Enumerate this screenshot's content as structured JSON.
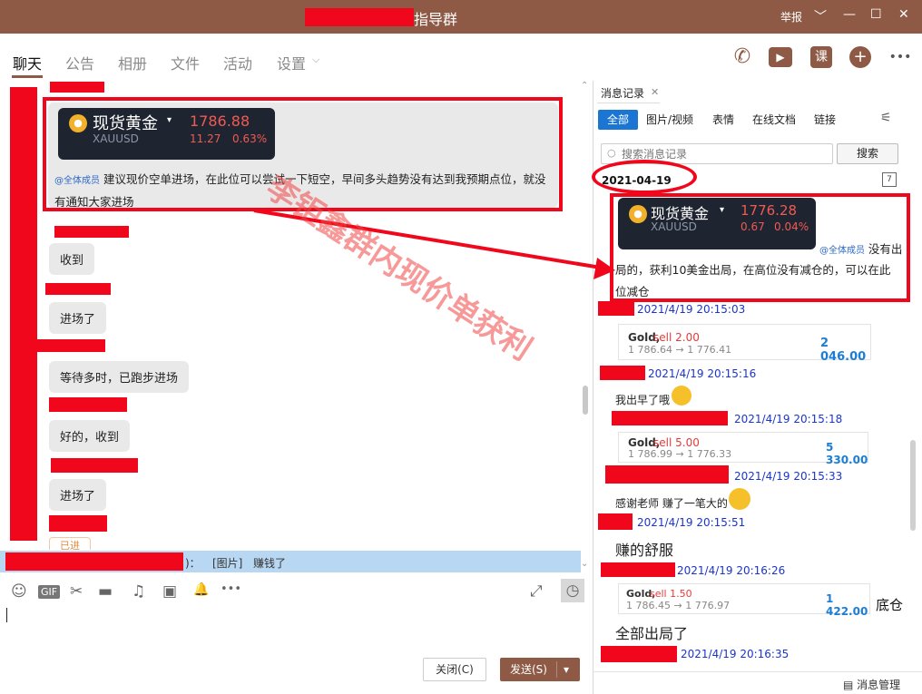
{
  "window": {
    "title": "指导群",
    "report": "举报",
    "controls": {
      "chevron": "﹀",
      "minimize": "—",
      "maximize": "☐",
      "close": "✕"
    }
  },
  "tabs": [
    "聊天",
    "公告",
    "相册",
    "文件",
    "活动",
    "设置"
  ],
  "toolbar_icons": [
    "phone-icon",
    "video-icon",
    "course-icon",
    "add-icon",
    "more-icon"
  ],
  "toolbar_glyphs": {
    "phone": "✆",
    "video": "▶",
    "course": "课",
    "add": "+",
    "more": "•••"
  },
  "quote_main": {
    "name": "现货黄金",
    "code": "XAUUSD",
    "price": "1786.88",
    "change": "11.27",
    "pct": "0.63%"
  },
  "pinned_message": {
    "mention": "@全体成员",
    "text": "建议现价空单进场，在此位可以尝试一下短空，早间多头趋势没有达到我预期点位，就没有通知大家进场"
  },
  "chat_messages": [
    "收到",
    "进场了",
    "等待多时，已跑步进场",
    "好的，收到",
    "进场了"
  ],
  "partial_bubble": "已进",
  "notification": {
    "sep": ")：",
    "image": "[图片]",
    "text": "赚钱了"
  },
  "input_tools": {
    "emoji": "☺",
    "gif": "GIF",
    "cut": "✂",
    "folder": "▬",
    "music": "♫",
    "image": "▣",
    "bell": "🔔",
    "more": "•••",
    "expand": "⤢",
    "clock": "◷"
  },
  "buttons": {
    "close": "关闭(C)",
    "send": "发送(S)",
    "send_arrow": "▾"
  },
  "right": {
    "tab_title": "消息记录",
    "tab_close": "✕",
    "filters": [
      "全部",
      "图片/视频",
      "表情",
      "在线文档",
      "链接"
    ],
    "filter_icon": "⚟",
    "search_placeholder": "搜索消息记录",
    "search_button": "搜索",
    "date": "2021-04-19",
    "calendar_icon": "7",
    "quote": {
      "name": "现货黄金",
      "code": "XAUUSD",
      "price": "1776.28",
      "change": "0.67",
      "pct": "0.04%"
    },
    "highlight": {
      "mention": "@全体成员",
      "text_a": "没有出",
      "text_b": "局的，获利10美金出局，在高位没有减仓的，可以在此",
      "text_c": "位减仓"
    },
    "records": [
      {
        "time": "2021/4/19 20:15:03"
      },
      {
        "time": "2021/4/19 20:15:16"
      },
      {
        "time": "2021/4/19 20:15:18"
      },
      {
        "time": "2021/4/19 20:15:33"
      },
      {
        "time": "2021/4/19 20:15:51"
      },
      {
        "time": "2021/4/19 20:16:26"
      },
      {
        "time": "2021/4/19 20:16:35"
      }
    ],
    "trades": [
      {
        "gold": "Gold,",
        "sell": "sell 2.00",
        "prices": "1 786.64 → 1 776.41",
        "value": "2 046.00"
      },
      {
        "gold": "Gold,",
        "sell": "sell 5.00",
        "prices": "1 786.99 → 1 776.33",
        "value": "5 330.00"
      },
      {
        "gold": "Gold,",
        "sell": "sell 1.50",
        "prices": "1 786.45 → 1 776.97",
        "value": "1 422.00"
      }
    ],
    "texts": [
      "我出早了哦",
      "感谢老师 赚了一笔大的",
      "赚的舒服",
      "全部出局了"
    ],
    "side_text": "底仓",
    "manage": "消息管理"
  },
  "watermark": "李钜鑫群内现价单获利"
}
